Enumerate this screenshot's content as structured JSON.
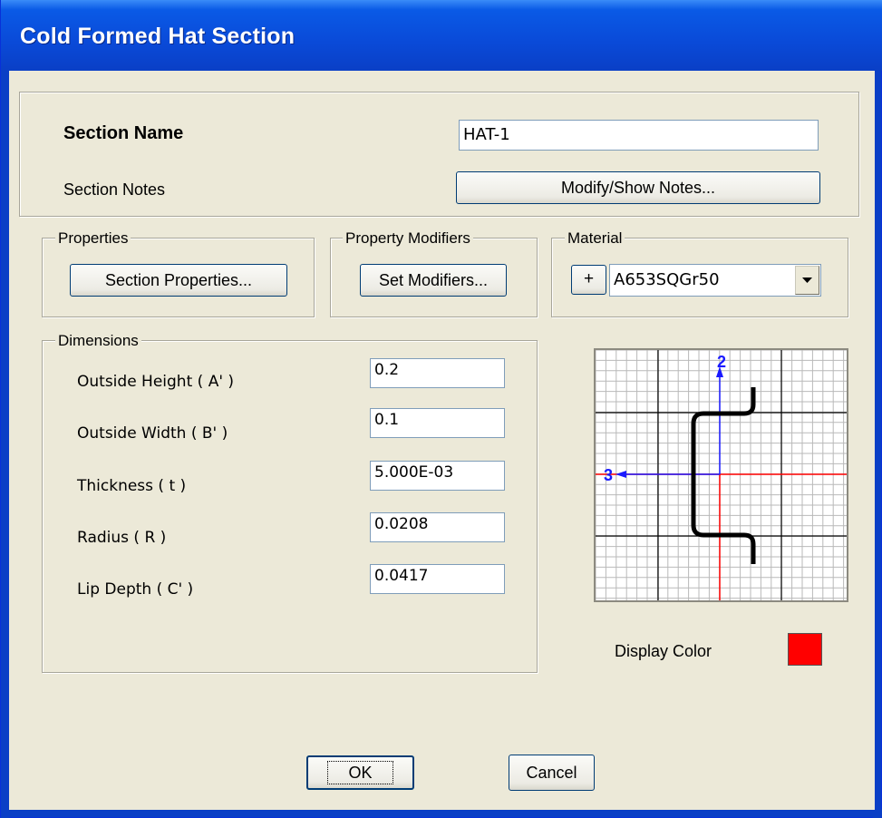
{
  "window": {
    "title": "Cold Formed Hat Section"
  },
  "section": {
    "name_label": "Section Name",
    "name_value": "HAT-1",
    "notes_label": "Section Notes",
    "notes_button": "Modify/Show Notes..."
  },
  "properties": {
    "group_label": "Properties",
    "button": "Section Properties..."
  },
  "modifiers": {
    "group_label": "Property Modifiers",
    "button": "Set Modifiers..."
  },
  "material": {
    "group_label": "Material",
    "add_button": "+",
    "selected": "A653SQGr50"
  },
  "dimensions": {
    "group_label": "Dimensions",
    "rows": [
      {
        "label": "Outside Height  ( A' )",
        "value": "0.2"
      },
      {
        "label": "Outside Width  ( B' )",
        "value": "0.1"
      },
      {
        "label": "Thickness  ( t )",
        "value": "5.000E-03"
      },
      {
        "label": "Radius  ( R )",
        "value": "0.0208"
      },
      {
        "label": "Lip Depth  ( C' )",
        "value": "0.0417"
      }
    ]
  },
  "preview": {
    "axis_2_label": "2",
    "axis_3_label": "3"
  },
  "display_color": {
    "label": "Display Color",
    "color": "#ff0000"
  },
  "buttons": {
    "ok": "OK",
    "cancel": "Cancel"
  },
  "colors": {
    "title_bar": "#0a4ad8",
    "dialog_bg": "#ece9d8",
    "axis_blue": "#1a1aff",
    "axis_red": "#ff0000"
  }
}
